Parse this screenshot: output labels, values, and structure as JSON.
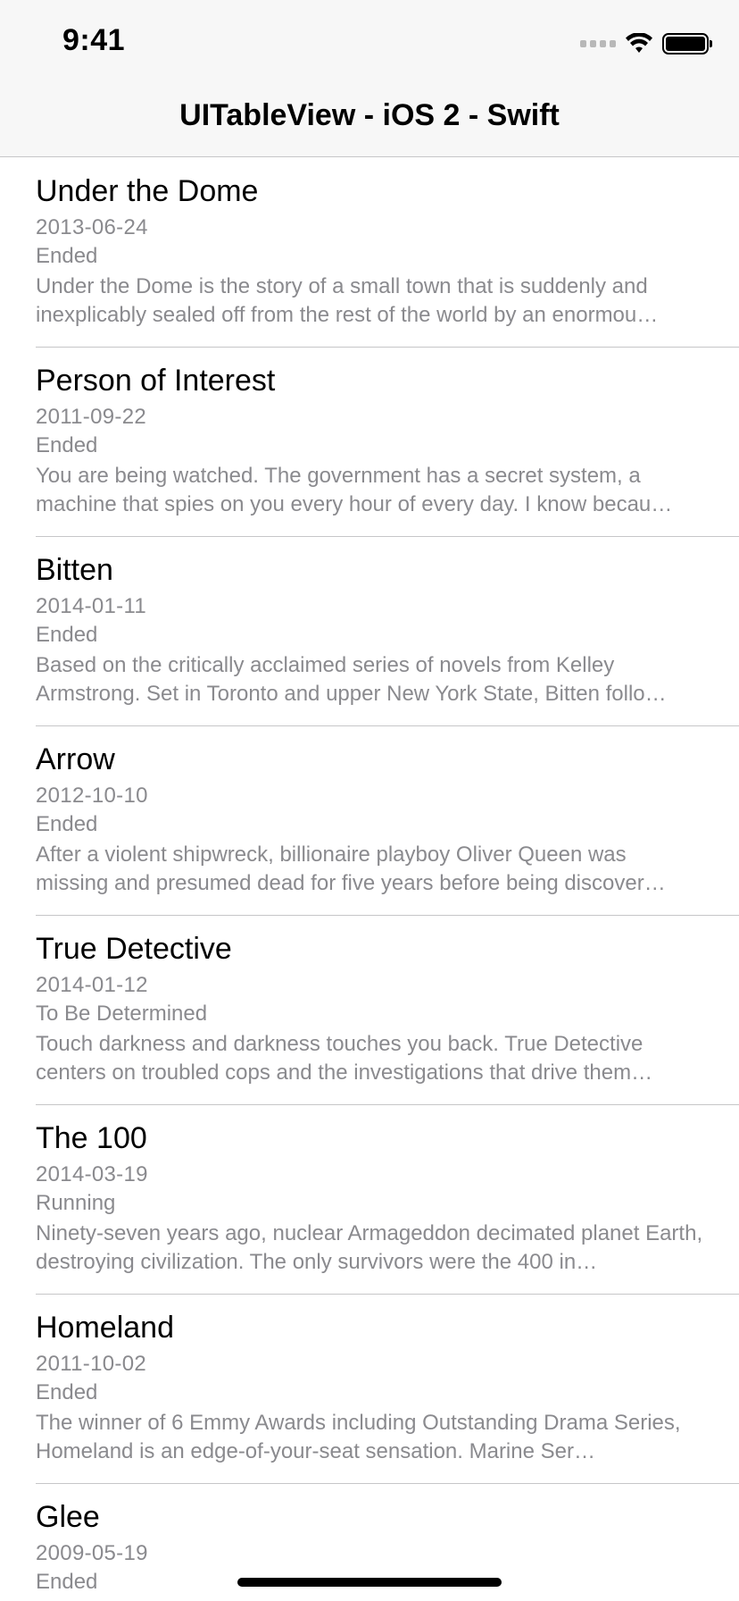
{
  "status_bar": {
    "time": "9:41",
    "icons": [
      "signal-icon",
      "wifi-icon",
      "battery-icon"
    ]
  },
  "nav": {
    "title": "UITableView - iOS 2 - Swift"
  },
  "shows": [
    {
      "title": "Under the Dome",
      "date": "2013-06-24",
      "status": "Ended",
      "description": "Under the Dome is the story of a small town that is suddenly and inexplicably sealed off from the rest of the world by an enormou…"
    },
    {
      "title": "Person of Interest",
      "date": "2011-09-22",
      "status": "Ended",
      "description": "You are being watched. The government has a secret system, a machine that spies on you every hour of every day. I know becau…"
    },
    {
      "title": "Bitten",
      "date": "2014-01-11",
      "status": "Ended",
      "description": "Based on the critically acclaimed series of novels from Kelley Armstrong. Set in Toronto and upper New York State, Bitten follo…"
    },
    {
      "title": "Arrow",
      "date": "2012-10-10",
      "status": "Ended",
      "description": "After a violent shipwreck, billionaire playboy Oliver Queen was missing and presumed dead for five years before being discover…"
    },
    {
      "title": "True Detective",
      "date": "2014-01-12",
      "status": "To Be Determined",
      "description": "Touch darkness and darkness touches you back. True Detective centers on troubled cops and the investigations that drive them…"
    },
    {
      "title": "The 100",
      "date": "2014-03-19",
      "status": "Running",
      "description": "Ninety-seven years ago, nuclear Armageddon decimated planet Earth, destroying civilization. The only survivors were the 400 in…"
    },
    {
      "title": "Homeland",
      "date": "2011-10-02",
      "status": "Ended",
      "description": "The winner of 6 Emmy Awards including Outstanding Drama Series, Homeland is an edge-of-your-seat sensation. Marine Ser…"
    },
    {
      "title": "Glee",
      "date": "2009-05-19",
      "status": "Ended",
      "description": ""
    }
  ]
}
